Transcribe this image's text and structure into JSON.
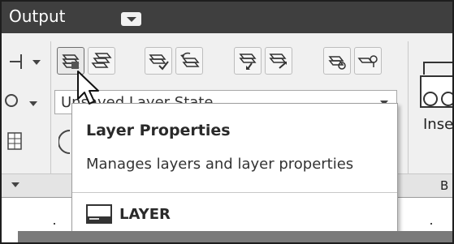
{
  "titlebar": {
    "tab_label": "Output",
    "dropdown_icon": "chevron-down-icon"
  },
  "ribbon": {
    "tools": [
      {
        "name": "layer-properties-button",
        "icon": "layer-properties-icon",
        "state": "hovered"
      },
      {
        "name": "layer-manager-button",
        "icon": "layer-stack-icon"
      },
      {
        "name": "make-current-button",
        "icon": "layer-check-icon"
      },
      {
        "name": "layer-previous-button",
        "icon": "layer-previous-icon"
      },
      {
        "name": "match-layer-button",
        "icon": "layer-match-icon"
      },
      {
        "name": "change-to-current-button",
        "icon": "layer-change-icon"
      },
      {
        "name": "layer-walk-button",
        "icon": "layer-walk-icon"
      },
      {
        "name": "layer-isolate-button",
        "icon": "layer-isolate-icon"
      }
    ],
    "layer_state": {
      "value": "Unsaved Layer State"
    },
    "insert_label": "Inse",
    "bottom_label": "B"
  },
  "tooltip": {
    "title": "Layer Properties",
    "description": "Manages layers and layer properties",
    "command": "LAYER",
    "command_icon": "command-line-icon"
  },
  "colors": {
    "titlebar_bg": "#3f3f3f",
    "ribbon_bg": "#f0f0f0",
    "tooltip_bg": "#ffffff"
  }
}
